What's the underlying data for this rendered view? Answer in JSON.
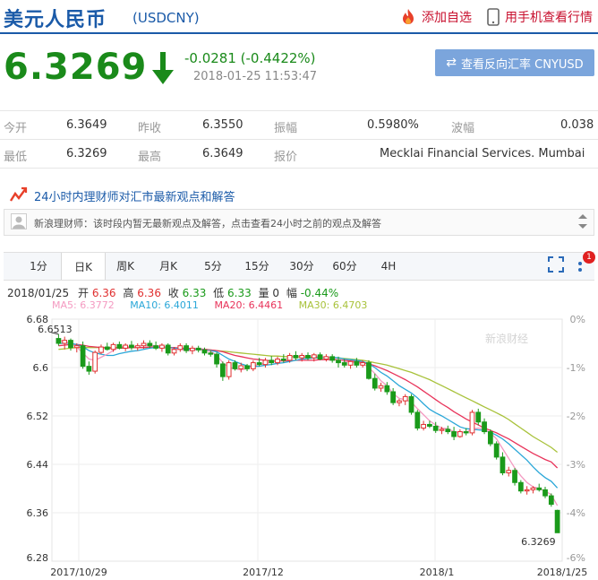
{
  "header": {
    "title": "美元人民币",
    "code": "(USDCNY)",
    "add_watchlist": "添加自选",
    "mobile_view": "用手机查看行情"
  },
  "quote": {
    "price": "6.3269",
    "change": "-0.0281 (-0.4422%)",
    "timestamp": "2018-01-25 11:53:47",
    "reverse_button": "查看反向汇率 CNYUSD",
    "down_color": "#1a8a1a"
  },
  "stats": {
    "row1": [
      {
        "label": "今开",
        "value": "6.3649"
      },
      {
        "label": "昨收",
        "value": "6.3550"
      },
      {
        "label": "振幅",
        "value": "0.5980%"
      },
      {
        "label": "波幅",
        "value": "0.038"
      }
    ],
    "row2": [
      {
        "label": "最低",
        "value": "6.3269"
      },
      {
        "label": "最高",
        "value": "6.3649"
      },
      {
        "label": "报价",
        "value": "Mecklai Financial Services. Mumbai"
      }
    ]
  },
  "qa": {
    "title": "24小时内理财师对汇市最新观点和解答",
    "message": "新浪理财师：该时段内暂无最新观点及解答，点击查看24小时之前的观点及解答"
  },
  "tabs": [
    "1分",
    "日K",
    "周K",
    "月K",
    "5分",
    "15分",
    "30分",
    "60分",
    "4H"
  ],
  "active_tab": "日K",
  "notification_count": "1",
  "chart_info": {
    "date": "2018/01/25",
    "open_label": "开",
    "open": "6.36",
    "high_label": "高",
    "high": "6.36",
    "close_label": "收",
    "close": "6.33",
    "low_label": "低",
    "low": "6.33",
    "volume_label": "量",
    "volume": "0",
    "range_label": "幅",
    "range": "-0.44%",
    "ma5": "MA5: 6.3772",
    "ma10": "MA10: 6.4011",
    "ma20": "MA20: 6.4461",
    "ma30": "MA30: 6.4703",
    "watermark": "新浪财经",
    "colors": {
      "up": "#e03030",
      "down": "#1a9a1a",
      "ma5": "#f49ac1",
      "ma10": "#2aa7d8",
      "ma20": "#e8335a",
      "ma30": "#a8c23a"
    }
  },
  "chart_data": {
    "type": "candlestick",
    "y_ticks": [
      "6.68",
      "6.6",
      "6.52",
      "6.44",
      "6.36",
      "6.28"
    ],
    "ylim": [
      6.28,
      6.68
    ],
    "pct_ticks": [
      "0%",
      "-1%",
      "-2%",
      "-3%",
      "-4%",
      "-6%"
    ],
    "x_ticks": [
      "2017/10/29",
      "2017/12",
      "2018/1",
      "2018/1/25"
    ],
    "max_label": "6.6513",
    "last_label": "6.3269",
    "candles": [
      [
        6.648,
        6.655,
        6.636,
        6.64
      ],
      [
        6.64,
        6.651,
        6.63,
        6.645
      ],
      [
        6.645,
        6.648,
        6.628,
        6.633
      ],
      [
        6.633,
        6.64,
        6.625,
        6.636
      ],
      [
        6.636,
        6.643,
        6.598,
        6.602
      ],
      [
        6.602,
        6.61,
        6.588,
        6.594
      ],
      [
        6.594,
        6.628,
        6.59,
        6.625
      ],
      [
        6.625,
        6.638,
        6.622,
        6.634
      ],
      [
        6.634,
        6.641,
        6.628,
        6.63
      ],
      [
        6.63,
        6.641,
        6.626,
        6.638
      ],
      [
        6.638,
        6.643,
        6.63,
        6.632
      ],
      [
        6.632,
        6.64,
        6.627,
        6.637
      ],
      [
        6.637,
        6.644,
        6.629,
        6.633
      ],
      [
        6.633,
        6.64,
        6.628,
        6.636
      ],
      [
        6.636,
        6.645,
        6.631,
        6.64
      ],
      [
        6.64,
        6.645,
        6.632,
        6.636
      ],
      [
        6.636,
        6.643,
        6.629,
        6.632
      ],
      [
        6.632,
        6.64,
        6.626,
        6.637
      ],
      [
        6.637,
        6.64,
        6.62,
        6.624
      ],
      [
        6.624,
        6.634,
        6.62,
        6.63
      ],
      [
        6.63,
        6.64,
        6.626,
        6.636
      ],
      [
        6.636,
        6.64,
        6.624,
        6.628
      ],
      [
        6.628,
        6.636,
        6.622,
        6.632
      ],
      [
        6.632,
        6.636,
        6.625,
        6.629
      ],
      [
        6.629,
        6.633,
        6.62,
        6.624
      ],
      [
        6.624,
        6.628,
        6.618,
        6.622
      ],
      [
        6.622,
        6.625,
        6.6,
        6.606
      ],
      [
        6.606,
        6.61,
        6.578,
        6.585
      ],
      [
        6.585,
        6.612,
        6.58,
        6.608
      ],
      [
        6.608,
        6.612,
        6.595,
        6.598
      ],
      [
        6.598,
        6.608,
        6.592,
        6.603
      ],
      [
        6.603,
        6.606,
        6.594,
        6.598
      ],
      [
        6.598,
        6.612,
        6.594,
        6.608
      ],
      [
        6.608,
        6.616,
        6.602,
        6.605
      ],
      [
        6.605,
        6.616,
        6.6,
        6.612
      ],
      [
        6.612,
        6.619,
        6.604,
        6.608
      ],
      [
        6.608,
        6.618,
        6.604,
        6.614
      ],
      [
        6.614,
        6.622,
        6.608,
        6.612
      ],
      [
        6.612,
        6.624,
        6.608,
        6.62
      ],
      [
        6.62,
        6.627,
        6.612,
        6.616
      ],
      [
        6.616,
        6.624,
        6.61,
        6.62
      ],
      [
        6.62,
        6.625,
        6.612,
        6.616
      ],
      [
        6.616,
        6.624,
        6.61,
        6.621
      ],
      [
        6.621,
        6.625,
        6.612,
        6.614
      ],
      [
        6.614,
        6.622,
        6.61,
        6.618
      ],
      [
        6.618,
        6.622,
        6.608,
        6.612
      ],
      [
        6.612,
        6.618,
        6.6,
        6.608
      ],
      [
        6.608,
        6.614,
        6.6,
        6.604
      ],
      [
        6.604,
        6.612,
        6.598,
        6.61
      ],
      [
        6.61,
        6.616,
        6.6,
        6.604
      ],
      [
        6.604,
        6.612,
        6.6,
        6.608
      ],
      [
        6.608,
        6.612,
        6.58,
        6.582
      ],
      [
        6.582,
        6.59,
        6.562,
        6.566
      ],
      [
        6.566,
        6.575,
        6.56,
        6.57
      ],
      [
        6.57,
        6.576,
        6.555,
        6.56
      ],
      [
        6.56,
        6.566,
        6.538,
        6.542
      ],
      [
        6.542,
        6.548,
        6.536,
        6.545
      ],
      [
        6.545,
        6.556,
        6.538,
        6.552
      ],
      [
        6.552,
        6.556,
        6.522,
        6.526
      ],
      [
        6.526,
        6.53,
        6.496,
        6.5
      ],
      [
        6.5,
        6.512,
        6.496,
        6.506
      ],
      [
        6.506,
        6.512,
        6.5,
        6.503
      ],
      [
        6.503,
        6.51,
        6.492,
        6.496
      ],
      [
        6.496,
        6.502,
        6.49,
        6.498
      ],
      [
        6.498,
        6.504,
        6.49,
        6.494
      ],
      [
        6.494,
        6.502,
        6.48,
        6.486
      ],
      [
        6.486,
        6.498,
        6.484,
        6.494
      ],
      [
        6.494,
        6.5,
        6.488,
        6.492
      ],
      [
        6.492,
        6.53,
        6.488,
        6.526
      ],
      [
        6.526,
        6.532,
        6.505,
        6.51
      ],
      [
        6.51,
        6.516,
        6.49,
        6.494
      ],
      [
        6.494,
        6.498,
        6.47,
        6.474
      ],
      [
        6.474,
        6.478,
        6.448,
        6.452
      ],
      [
        6.452,
        6.46,
        6.422,
        6.426
      ],
      [
        6.426,
        6.436,
        6.42,
        6.43
      ],
      [
        6.43,
        6.434,
        6.405,
        6.41
      ],
      [
        6.41,
        6.414,
        6.392,
        6.396
      ],
      [
        6.396,
        6.404,
        6.39,
        6.398
      ],
      [
        6.398,
        6.404,
        6.392,
        6.401
      ],
      [
        6.401,
        6.408,
        6.395,
        6.398
      ],
      [
        6.398,
        6.403,
        6.384,
        6.388
      ],
      [
        6.388,
        6.392,
        6.37,
        6.374
      ],
      [
        6.364,
        6.365,
        6.327,
        6.327
      ]
    ],
    "ma5": [
      6.645,
      6.643,
      6.64,
      6.634,
      6.624,
      6.614,
      6.612,
      6.617,
      6.622,
      6.628,
      6.634,
      6.635,
      6.634,
      6.635,
      6.637,
      6.637,
      6.636,
      6.636,
      6.633,
      6.63,
      6.63,
      6.628,
      6.628,
      6.63,
      6.628,
      6.627,
      6.62,
      6.608,
      6.6,
      6.598,
      6.596,
      6.598,
      6.603,
      6.605,
      6.607,
      6.609,
      6.611,
      6.613,
      6.616,
      6.618,
      6.619,
      6.619,
      6.619,
      6.618,
      6.617,
      6.616,
      6.613,
      6.61,
      6.609,
      6.608,
      6.607,
      6.6,
      6.59,
      6.578,
      6.57,
      6.557,
      6.549,
      6.547,
      6.543,
      6.532,
      6.522,
      6.512,
      6.505,
      6.5,
      6.499,
      6.494,
      6.493,
      6.493,
      6.498,
      6.5,
      6.498,
      6.492,
      6.482,
      6.466,
      6.45,
      6.434,
      6.421,
      6.41,
      6.403,
      6.4,
      6.396,
      6.39,
      6.372
    ],
    "ma10": [
      6.64,
      6.64,
      6.64,
      6.638,
      6.634,
      6.628,
      6.624,
      6.622,
      6.62,
      6.62,
      6.623,
      6.625,
      6.627,
      6.628,
      6.63,
      6.632,
      6.633,
      6.634,
      6.633,
      6.632,
      6.631,
      6.63,
      6.63,
      6.63,
      6.629,
      6.628,
      6.626,
      6.62,
      6.614,
      6.61,
      6.606,
      6.603,
      6.602,
      6.602,
      6.604,
      6.605,
      6.607,
      6.608,
      6.61,
      6.612,
      6.614,
      6.615,
      6.616,
      6.616,
      6.617,
      6.617,
      6.616,
      6.614,
      6.613,
      6.612,
      6.61,
      6.606,
      6.6,
      6.592,
      6.586,
      6.578,
      6.57,
      6.564,
      6.558,
      6.55,
      6.54,
      6.531,
      6.525,
      6.52,
      6.514,
      6.508,
      6.502,
      6.499,
      6.498,
      6.497,
      6.496,
      6.493,
      6.488,
      6.482,
      6.474,
      6.465,
      6.456,
      6.447,
      6.436,
      6.426,
      6.418,
      6.412,
      6.401
    ],
    "ma20": [
      6.636,
      6.637,
      6.638,
      6.638,
      6.637,
      6.635,
      6.634,
      6.633,
      6.632,
      6.632,
      6.632,
      6.632,
      6.633,
      6.633,
      6.633,
      6.634,
      6.634,
      6.634,
      6.633,
      6.633,
      6.632,
      6.632,
      6.631,
      6.631,
      6.63,
      6.629,
      6.628,
      6.626,
      6.623,
      6.62,
      6.618,
      6.616,
      6.614,
      6.613,
      6.612,
      6.611,
      6.611,
      6.611,
      6.611,
      6.612,
      6.612,
      6.612,
      6.612,
      6.613,
      6.613,
      6.613,
      6.613,
      6.612,
      6.611,
      6.61,
      6.608,
      6.606,
      6.603,
      6.599,
      6.595,
      6.59,
      6.585,
      6.58,
      6.574,
      6.568,
      6.561,
      6.554,
      6.547,
      6.54,
      6.534,
      6.527,
      6.521,
      6.515,
      6.51,
      6.505,
      6.5,
      6.496,
      6.492,
      6.487,
      6.482,
      6.476,
      6.47,
      6.464,
      6.458,
      6.453,
      6.448,
      6.444,
      6.434
    ],
    "ma30": [
      6.63,
      6.631,
      6.632,
      6.633,
      6.633,
      6.633,
      6.633,
      6.633,
      6.633,
      6.633,
      6.633,
      6.633,
      6.633,
      6.633,
      6.633,
      6.633,
      6.633,
      6.633,
      6.632,
      6.632,
      6.632,
      6.631,
      6.631,
      6.63,
      6.63,
      6.629,
      6.628,
      6.627,
      6.626,
      6.625,
      6.624,
      6.623,
      6.622,
      6.621,
      6.62,
      6.619,
      6.619,
      6.618,
      6.618,
      6.618,
      6.617,
      6.617,
      6.617,
      6.617,
      6.616,
      6.616,
      6.616,
      6.615,
      6.614,
      6.613,
      6.612,
      6.61,
      6.608,
      6.606,
      6.604,
      6.601,
      6.598,
      6.595,
      6.592,
      6.588,
      6.584,
      6.58,
      6.575,
      6.57,
      6.565,
      6.56,
      6.555,
      6.55,
      6.545,
      6.54,
      6.535,
      6.53,
      6.525,
      6.52,
      6.514,
      6.507,
      6.5,
      6.493,
      6.486,
      6.48,
      6.474,
      6.468,
      6.46
    ]
  }
}
